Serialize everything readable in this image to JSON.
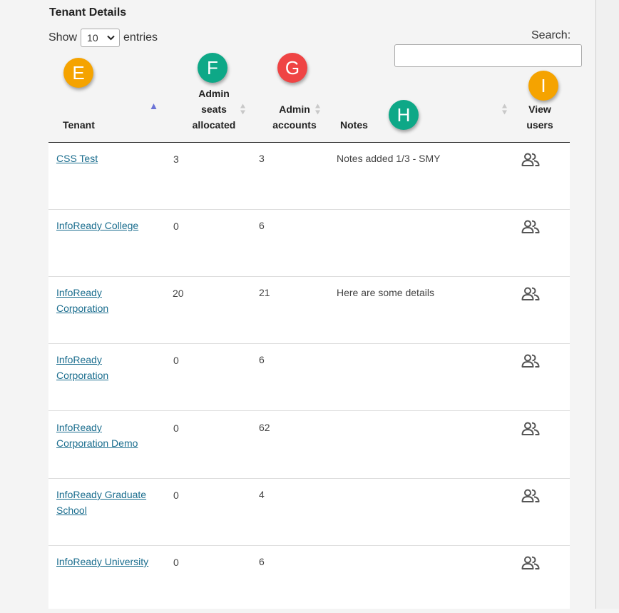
{
  "section_title": "Tenant Details",
  "length_menu": {
    "prefix": "Show",
    "value": "10",
    "suffix": "entries"
  },
  "search": {
    "label": "Search:",
    "value": "",
    "placeholder": ""
  },
  "badges": [
    {
      "letter": "E",
      "color": "#f5a300"
    },
    {
      "letter": "F",
      "color": "#0ea887"
    },
    {
      "letter": "G",
      "color": "#ef4444"
    },
    {
      "letter": "H",
      "color": "#0ea887"
    },
    {
      "letter": "I",
      "color": "#f5a300"
    }
  ],
  "columns": {
    "tenant": "Tenant",
    "admin_seats_1": "Admin",
    "admin_seats_2": "seats",
    "admin_seats_3": "allocated",
    "admin_accounts_1": "Admin",
    "admin_accounts_2": "accounts",
    "notes": "Notes",
    "view_users_1": "View",
    "view_users_2": "users"
  },
  "rows": [
    {
      "tenant_1": "CSS Test",
      "tenant_2": "",
      "seats": "3",
      "accounts": "3",
      "notes": "Notes added 1/3 - SMY",
      "icon": "users-icon"
    },
    {
      "tenant_1": "InfoReady College",
      "tenant_2": "",
      "seats": "0",
      "accounts": "6",
      "notes": "",
      "icon": "users-icon"
    },
    {
      "tenant_1": "InfoReady",
      "tenant_2": "Corporation",
      "seats": "20",
      "accounts": "21",
      "notes": "Here are some details",
      "icon": "users-icon"
    },
    {
      "tenant_1": "InfoReady",
      "tenant_2": "Corporation",
      "seats": "0",
      "accounts": "6",
      "notes": "",
      "icon": "users-icon"
    },
    {
      "tenant_1": "InfoReady",
      "tenant_2": "Corporation Demo",
      "seats": "0",
      "accounts": "62",
      "notes": "",
      "icon": "users-icon"
    },
    {
      "tenant_1": "InfoReady Graduate",
      "tenant_2": "School",
      "seats": "0",
      "accounts": "4",
      "notes": "",
      "icon": "users-icon"
    },
    {
      "tenant_1": "InfoReady University",
      "tenant_2": "",
      "seats": "0",
      "accounts": "6",
      "notes": "",
      "icon": "users-icon"
    }
  ],
  "colors": {
    "link": "#1a6d8e",
    "header_rule": "#222222",
    "row_divider": "#dddddd",
    "sort_active": "#6b73d6",
    "sort_inactive": "#c8c8c8"
  }
}
